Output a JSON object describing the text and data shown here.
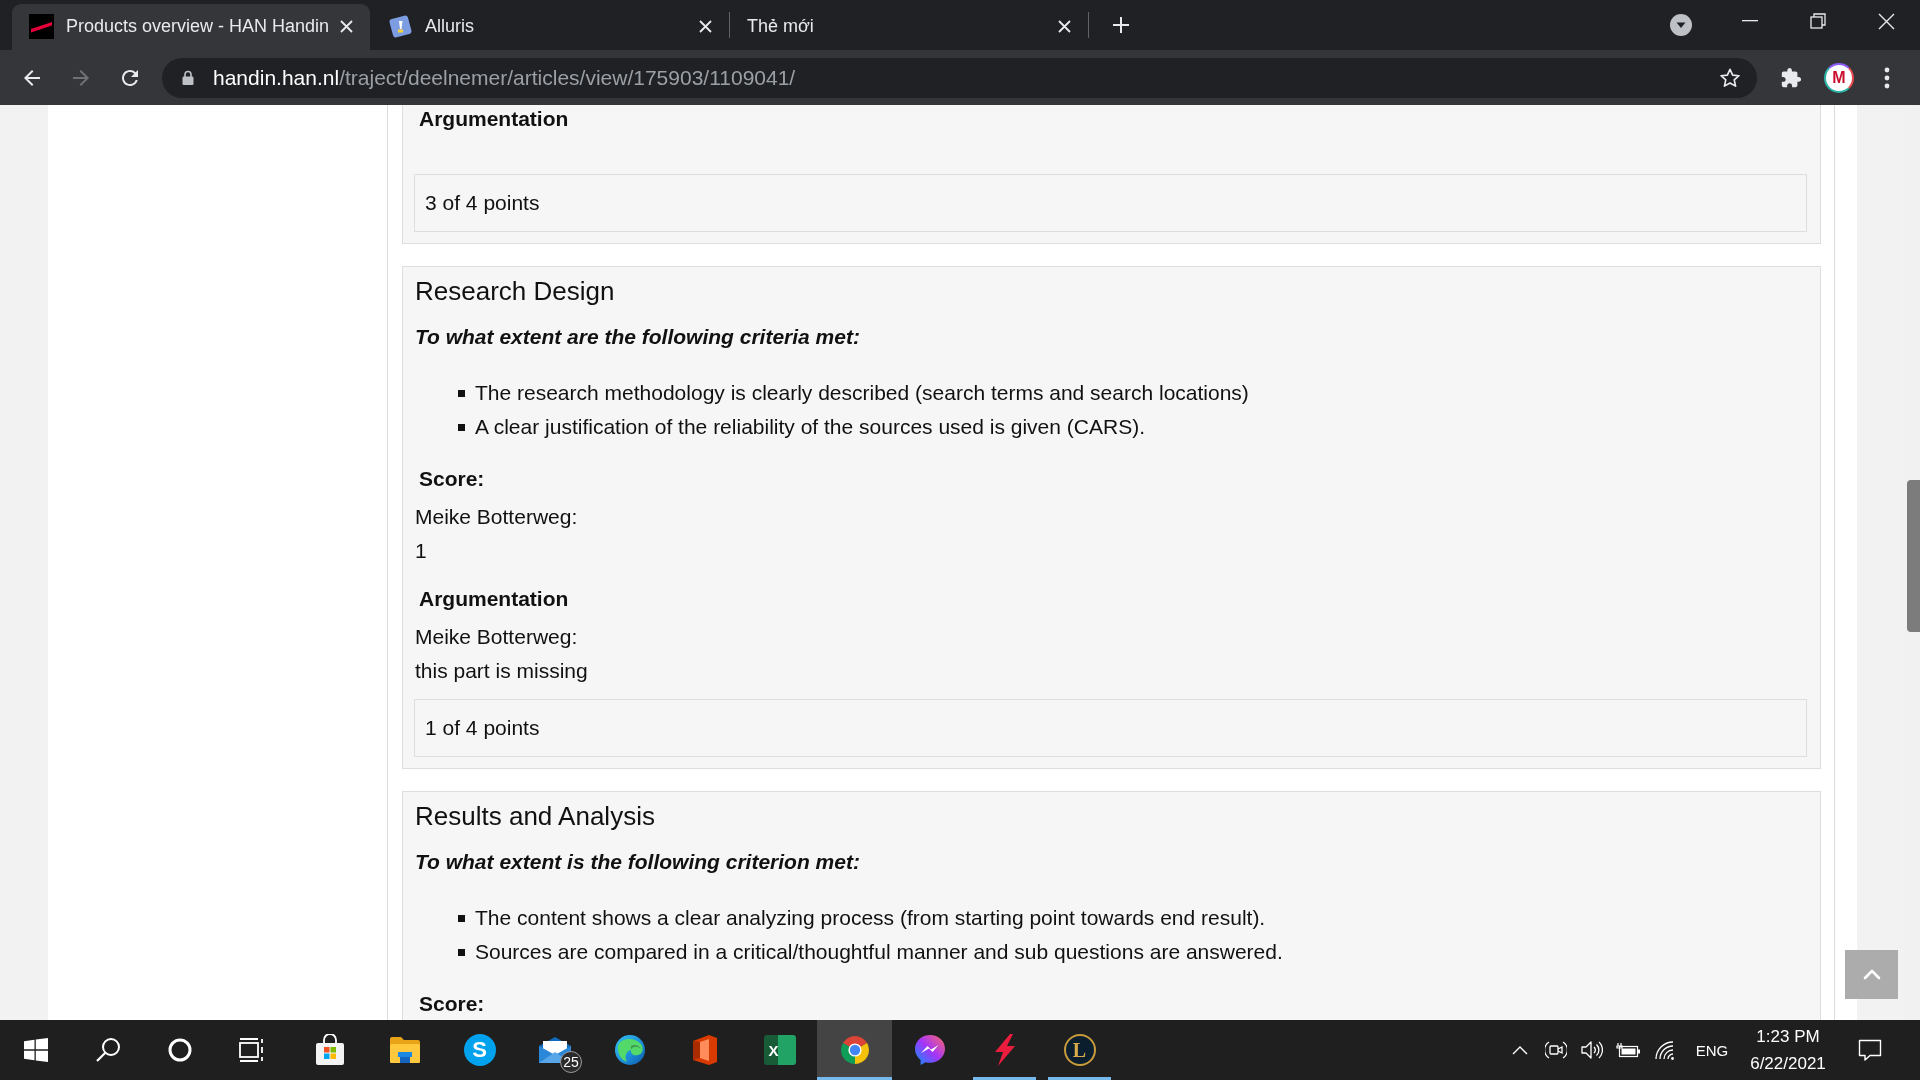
{
  "browser": {
    "tabs": [
      {
        "title": "Products overview - HAN Handin",
        "selected": true
      },
      {
        "title": "Alluris",
        "selected": false
      },
      {
        "title": "Thẻ mới",
        "selected": false
      }
    ],
    "forward_disabled": true,
    "address_bar": {
      "host": "handin.han.nl",
      "path": "/traject/deelnemer/articles/view/175903/1109041/"
    },
    "profile_initial": "M"
  },
  "page": {
    "sections": [
      {
        "argumentation_heading": "Argumentation",
        "points": "3 of 4 points"
      },
      {
        "title": "Research Design",
        "question": "To what extent are the following criteria met:",
        "criteria": [
          "The research methodology is clearly described (search terms and search locations)",
          "A clear justification of the reliability of the sources used is given (CARS)."
        ],
        "score_heading": "Score:",
        "score_author": "Meike Botterweg:",
        "score_value": "1",
        "argumentation_heading": "Argumentation",
        "argumentation_author": "Meike Botterweg:",
        "argumentation_text": "this part is missing",
        "points": "1 of 4 points"
      },
      {
        "title": "Results and Analysis",
        "question": "To what extent is the following criterion met:",
        "criteria": [
          "The content shows a clear analyzing process (from starting point towards end result).",
          "Sources are compared in a critical/thoughtful manner and sub questions are answered."
        ],
        "score_heading": "Score:"
      }
    ]
  },
  "taskbar": {
    "apps": [
      {
        "kind": "start",
        "running": false,
        "selected": false
      },
      {
        "kind": "search",
        "running": false,
        "selected": false
      },
      {
        "kind": "cortana",
        "running": false,
        "selected": false
      },
      {
        "kind": "taskview",
        "running": false,
        "selected": false
      },
      {
        "kind": "store",
        "running": false,
        "selected": false
      },
      {
        "kind": "explorer",
        "running": false,
        "selected": false
      },
      {
        "kind": "skype",
        "glyph": "S",
        "running": false,
        "selected": false
      },
      {
        "kind": "mail",
        "badge": "25",
        "running": false,
        "selected": false
      },
      {
        "kind": "edge",
        "running": false,
        "selected": false
      },
      {
        "kind": "office",
        "running": false,
        "selected": false
      },
      {
        "kind": "excel",
        "glyph": "X",
        "running": false,
        "selected": false
      },
      {
        "kind": "chrome",
        "running": true,
        "selected": true
      },
      {
        "kind": "messenger",
        "running": false,
        "selected": false
      },
      {
        "kind": "bolt",
        "running": true,
        "selected": false
      },
      {
        "kind": "league",
        "glyph": "L",
        "running": true,
        "selected": false
      }
    ],
    "tray": {
      "language": "ENG",
      "time": "1:23 PM",
      "date": "6/22/2021"
    }
  }
}
